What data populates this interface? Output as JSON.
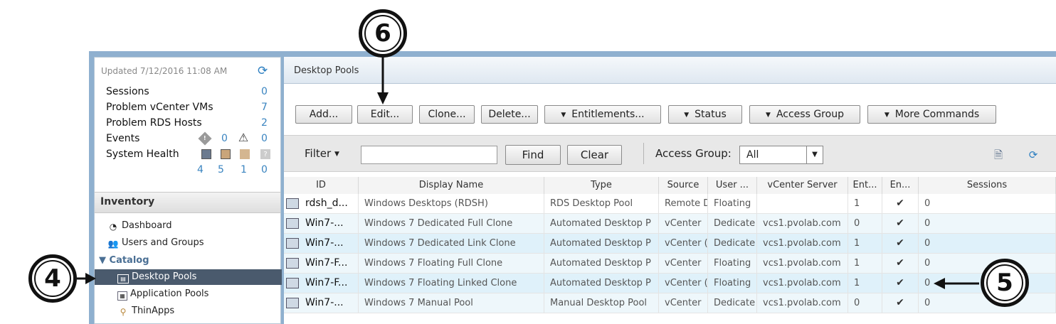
{
  "left_panel": {
    "updated": "Updated 7/12/2016 11:08 AM",
    "stats": [
      {
        "label": "Sessions",
        "value": "0"
      },
      {
        "label": "Problem vCenter VMs",
        "value": "7"
      },
      {
        "label": "Problem RDS Hosts",
        "value": "2"
      },
      {
        "label": "Events",
        "value": ""
      },
      {
        "label": "System Health",
        "value": ""
      }
    ],
    "events_values": [
      "0",
      "0"
    ],
    "health_values": [
      "4",
      "5",
      "1",
      "0"
    ],
    "inventory_title": "Inventory",
    "nav": {
      "dashboard": "Dashboard",
      "users_groups": "Users and Groups",
      "catalog": "Catalog",
      "desktop_pools": "Desktop Pools",
      "application_pools": "Application Pools",
      "thinapps": "ThinApps"
    }
  },
  "main": {
    "tab_title": "Desktop Pools",
    "toolbar": {
      "add": "Add...",
      "edit": "Edit...",
      "clone": "Clone...",
      "delete": "Delete...",
      "entitlements": "Entitlements...",
      "status": "Status",
      "access_group": "Access Group",
      "more_commands": "More Commands"
    },
    "filter": {
      "filter_label": "Filter",
      "input_value": "",
      "find": "Find",
      "clear": "Clear",
      "access_group_label": "Access Group:",
      "access_group_value": "All"
    },
    "table": {
      "headers": [
        "ID",
        "Display Name",
        "Type",
        "Source",
        "User ...",
        "vCenter Server",
        "Ent...",
        "En...",
        "Sessions"
      ],
      "rows": [
        {
          "id": "rdsh_d...",
          "name": "Windows Desktops (RDSH)",
          "type": "RDS Desktop Pool",
          "source": "Remote D",
          "user": "Floating",
          "vcenter": "",
          "ent": "1",
          "en": "✔",
          "sessions": "0"
        },
        {
          "id": "Win7-...",
          "name": "Windows 7 Dedicated Full Clone",
          "type": "Automated Desktop P",
          "source": "vCenter",
          "user": "Dedicate",
          "vcenter": "vcs1.pvolab.com",
          "ent": "0",
          "en": "✔",
          "sessions": "0"
        },
        {
          "id": "Win7-...",
          "name": "Windows 7 Dedicated Link Clone",
          "type": "Automated Desktop P",
          "source": "vCenter (",
          "user": "Dedicate",
          "vcenter": "vcs1.pvolab.com",
          "ent": "1",
          "en": "✔",
          "sessions": "0"
        },
        {
          "id": "Win7-F...",
          "name": "Windows 7 Floating Full Clone",
          "type": "Automated Desktop P",
          "source": "vCenter",
          "user": "Floating",
          "vcenter": "vcs1.pvolab.com",
          "ent": "1",
          "en": "✔",
          "sessions": "0"
        },
        {
          "id": "Win7-F...",
          "name": "Windows 7 Floating Linked Clone",
          "type": "Automated Desktop P",
          "source": "vCenter (",
          "user": "Floating",
          "vcenter": "vcs1.pvolab.com",
          "ent": "1",
          "en": "✔",
          "sessions": "0"
        },
        {
          "id": "Win7-...",
          "name": "Windows 7 Manual Pool",
          "type": "Manual Desktop Pool",
          "source": "vCenter",
          "user": "Dedicate",
          "vcenter": "vcs1.pvolab.com",
          "ent": "0",
          "en": "✔",
          "sessions": "0"
        }
      ]
    }
  },
  "callouts": {
    "c4": "4",
    "c5": "5",
    "c6": "6"
  },
  "icons": {
    "refresh": "refresh-icon",
    "warning": "warning-icon",
    "export": "export-icon"
  }
}
